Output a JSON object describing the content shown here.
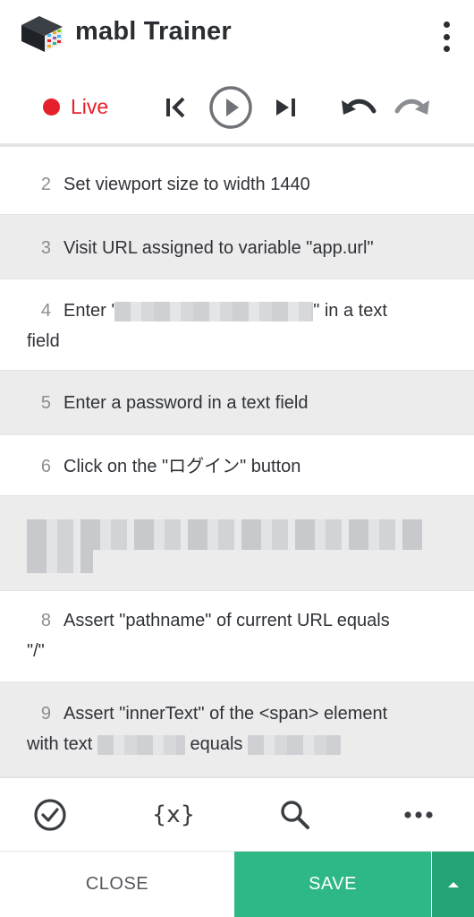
{
  "header": {
    "title": "mabl Trainer",
    "menu_icon": "kebab-menu-icon"
  },
  "toolbar": {
    "live_label": "Live",
    "live_color": "#e5202a",
    "icons": [
      "skip-to-start-icon",
      "play-icon",
      "skip-to-end-icon",
      "undo-icon",
      "redo-icon"
    ]
  },
  "steps": [
    {
      "num": "2",
      "text": "Set viewport size to width 1440"
    },
    {
      "num": "3",
      "text": "Visit URL assigned to variable \"app.url\""
    },
    {
      "num": "4",
      "text_before": "Enter '",
      "text_after": "\" in a text",
      "text_line2": "field"
    },
    {
      "num": "5",
      "text": "Enter a password in a text field"
    },
    {
      "num": "6",
      "text": "Click on the \"ログイン\" button"
    },
    {
      "num": "7"
    },
    {
      "num": "8",
      "text": "Assert \"pathname\" of current URL equals",
      "text_line2": "\"/\""
    },
    {
      "num": "9",
      "text": "Assert \"innerText\" of the <span> element",
      "text_line2_before": "with text",
      "text_line2_mid": "equals"
    }
  ],
  "bottom_tools": {
    "variables_label": "{x}",
    "icons": [
      "check-circle-icon",
      "variables-icon",
      "search-icon",
      "more-icon"
    ]
  },
  "footer": {
    "close_label": "CLOSE",
    "save_label": "SAVE",
    "save_color": "#2eb886"
  }
}
